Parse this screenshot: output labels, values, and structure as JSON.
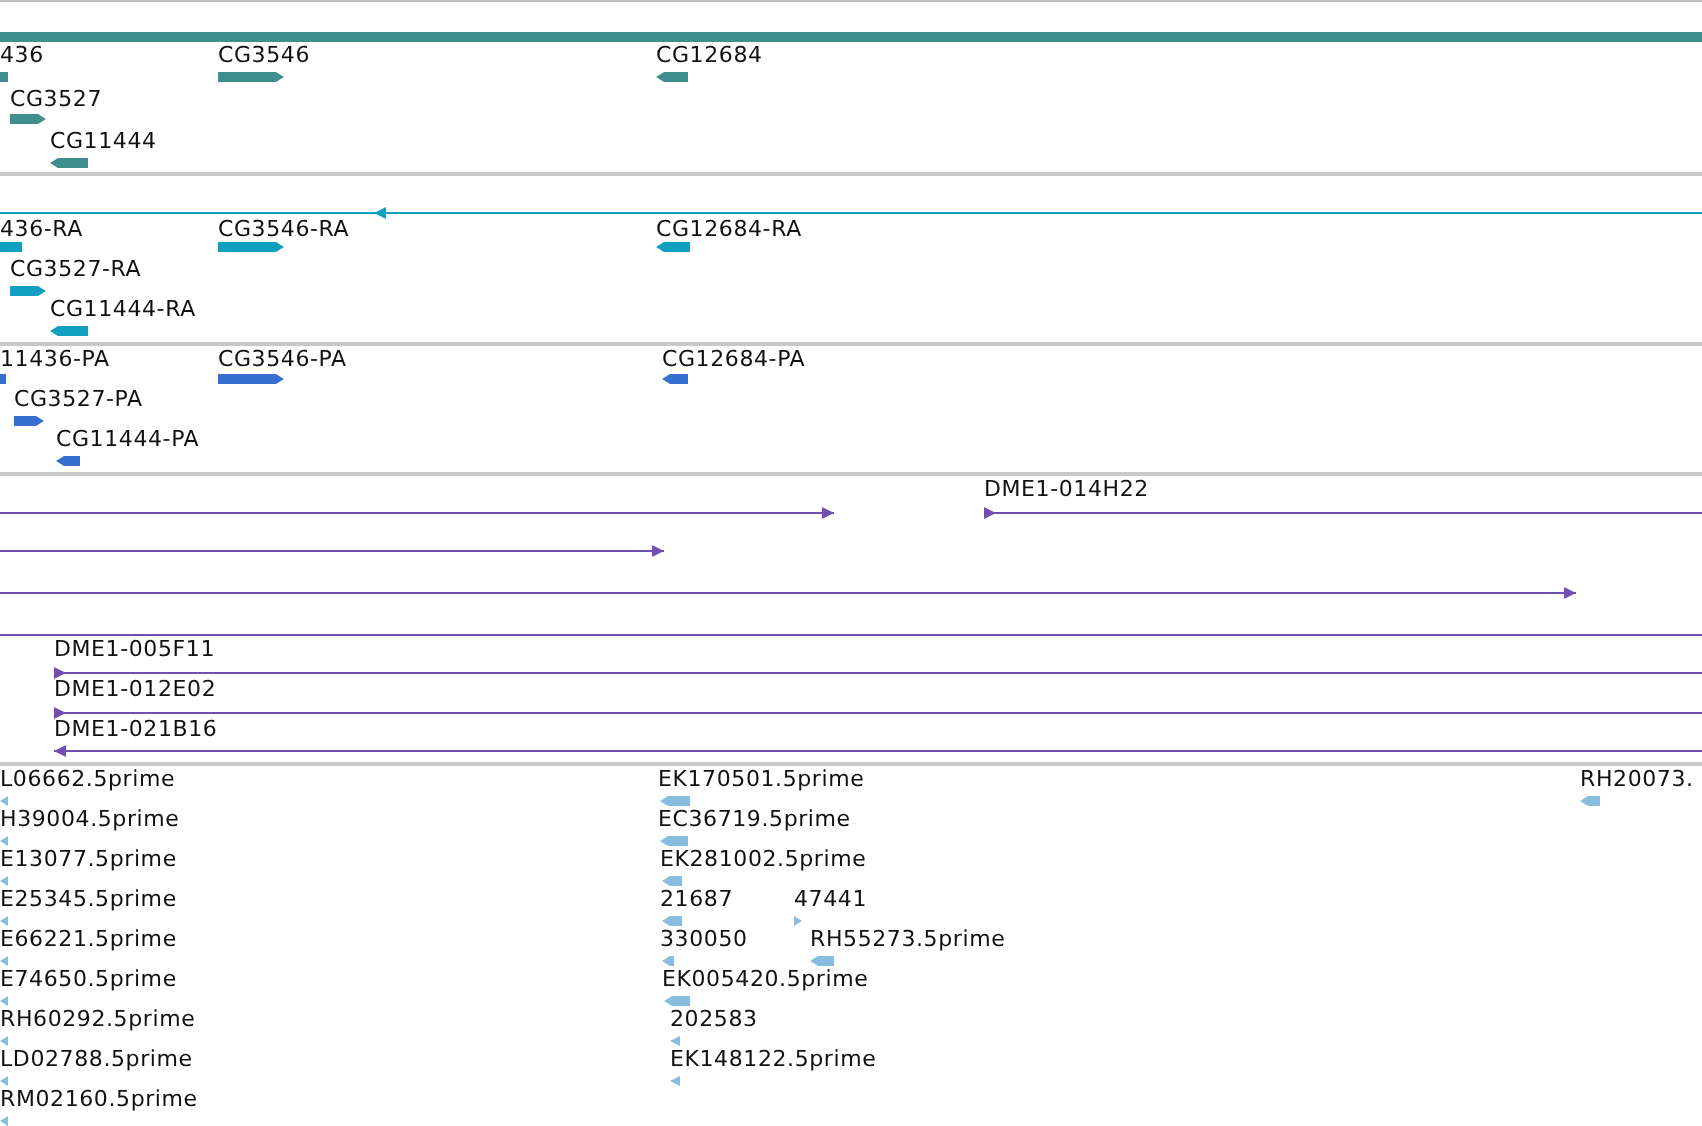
{
  "tracks": [
    {
      "color": "#3f8f8f",
      "features": [
        {
          "kind": "block"
        },
        {
          "kind": "block",
          "label": "436"
        },
        {
          "kind": "block",
          "label": "CG3546",
          "reverse": false
        },
        {
          "kind": "block",
          "label": "CG12684",
          "reverse": true
        },
        {
          "kind": "block",
          "label": "CG3527",
          "reverse": false
        },
        {
          "kind": "block",
          "label": "CG11444",
          "reverse": true
        }
      ]
    },
    {
      "color": "#0fa0c0",
      "features": [
        {
          "kind": "line",
          "reverse": true
        },
        {
          "kind": "block",
          "label": "436-RA"
        },
        {
          "kind": "block",
          "label": "CG3546-RA",
          "reverse": false
        },
        {
          "kind": "block",
          "label": "CG12684-RA",
          "reverse": true
        },
        {
          "kind": "block",
          "label": "CG3527-RA",
          "reverse": false
        },
        {
          "kind": "block",
          "label": "CG11444-RA",
          "reverse": true
        }
      ]
    },
    {
      "color": "#3570d0",
      "features": [
        {
          "kind": "block",
          "label": "11436-PA"
        },
        {
          "kind": "block",
          "label": "CG3546-PA",
          "reverse": false
        },
        {
          "kind": "block",
          "label": "CG12684-PA",
          "reverse": true
        },
        {
          "kind": "block",
          "label": "CG3527-PA",
          "reverse": false
        },
        {
          "kind": "block",
          "label": "CG11444-PA",
          "reverse": true
        }
      ]
    },
    {
      "color": "#7050b0",
      "features": [
        {
          "kind": "line",
          "reverse": false
        },
        {
          "kind": "line",
          "label": "DME1-014H22",
          "reverse": false
        },
        {
          "kind": "line",
          "reverse": false
        },
        {
          "kind": "line",
          "reverse": false
        },
        {
          "kind": "line"
        },
        {
          "kind": "line",
          "label": "DME1-005F11",
          "reverse": false
        },
        {
          "kind": "line",
          "label": "DME1-012E02",
          "reverse": false
        },
        {
          "kind": "line",
          "label": "DME1-021B16",
          "reverse": true
        }
      ]
    },
    {
      "color": "#88bde0",
      "features": [
        {
          "kind": "block",
          "label": "L06662.5prime",
          "reverse": true
        },
        {
          "kind": "block",
          "label": "EK170501.5prime",
          "reverse": true
        },
        {
          "kind": "block",
          "label": "RH20073.",
          "reverse": true
        },
        {
          "kind": "block",
          "label": "H39004.5prime",
          "reverse": true
        },
        {
          "kind": "block",
          "label": "EC36719.5prime",
          "reverse": true
        },
        {
          "kind": "block",
          "label": "E13077.5prime",
          "reverse": true
        },
        {
          "kind": "block",
          "label": "EK281002.5prime",
          "reverse": true
        },
        {
          "kind": "block",
          "label": "E25345.5prime",
          "reverse": true
        },
        {
          "kind": "block",
          "label": "21687",
          "reverse": true
        },
        {
          "kind": "block",
          "label": "47441",
          "reverse": false
        },
        {
          "kind": "block",
          "label": "E66221.5prime",
          "reverse": true
        },
        {
          "kind": "block",
          "label": "330050",
          "reverse": true
        },
        {
          "kind": "block",
          "label": "RH55273.5prime",
          "reverse": true
        },
        {
          "kind": "block",
          "label": "E74650.5prime",
          "reverse": true
        },
        {
          "kind": "block",
          "label": "EK005420.5prime",
          "reverse": true
        },
        {
          "kind": "block",
          "label": "RH60292.5prime",
          "reverse": true
        },
        {
          "kind": "block",
          "label": "202583",
          "reverse": true
        },
        {
          "kind": "block",
          "label": "LD02788.5prime",
          "reverse": true
        },
        {
          "kind": "block",
          "label": "EK148122.5prime",
          "reverse": true
        },
        {
          "kind": "block",
          "label": "RM02160.5prime",
          "reverse": true
        }
      ]
    }
  ]
}
